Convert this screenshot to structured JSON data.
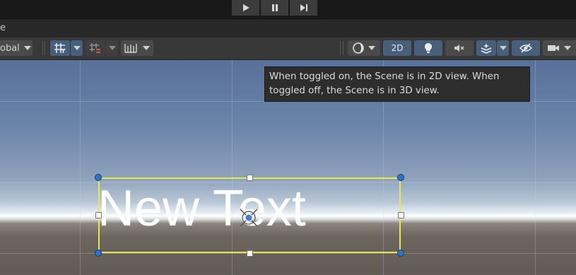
{
  "playbar": {
    "buttons": [
      {
        "name": "play-icon"
      },
      {
        "name": "pause-icon"
      },
      {
        "name": "step-icon"
      }
    ]
  },
  "window_tab": {
    "label": "e"
  },
  "toolbar": {
    "global_label": "obal",
    "toggle_2d_label": "2D"
  },
  "tooltip": {
    "line1": "When toggled on, the Scene is in 2D view. When",
    "line2": "toggled off, the Scene is in 3D view."
  },
  "scene": {
    "text_object": "New Text",
    "colors": {
      "selection": "#e7e84a",
      "handle_corner": "#2e73d0",
      "active_button": "#46607c"
    }
  }
}
